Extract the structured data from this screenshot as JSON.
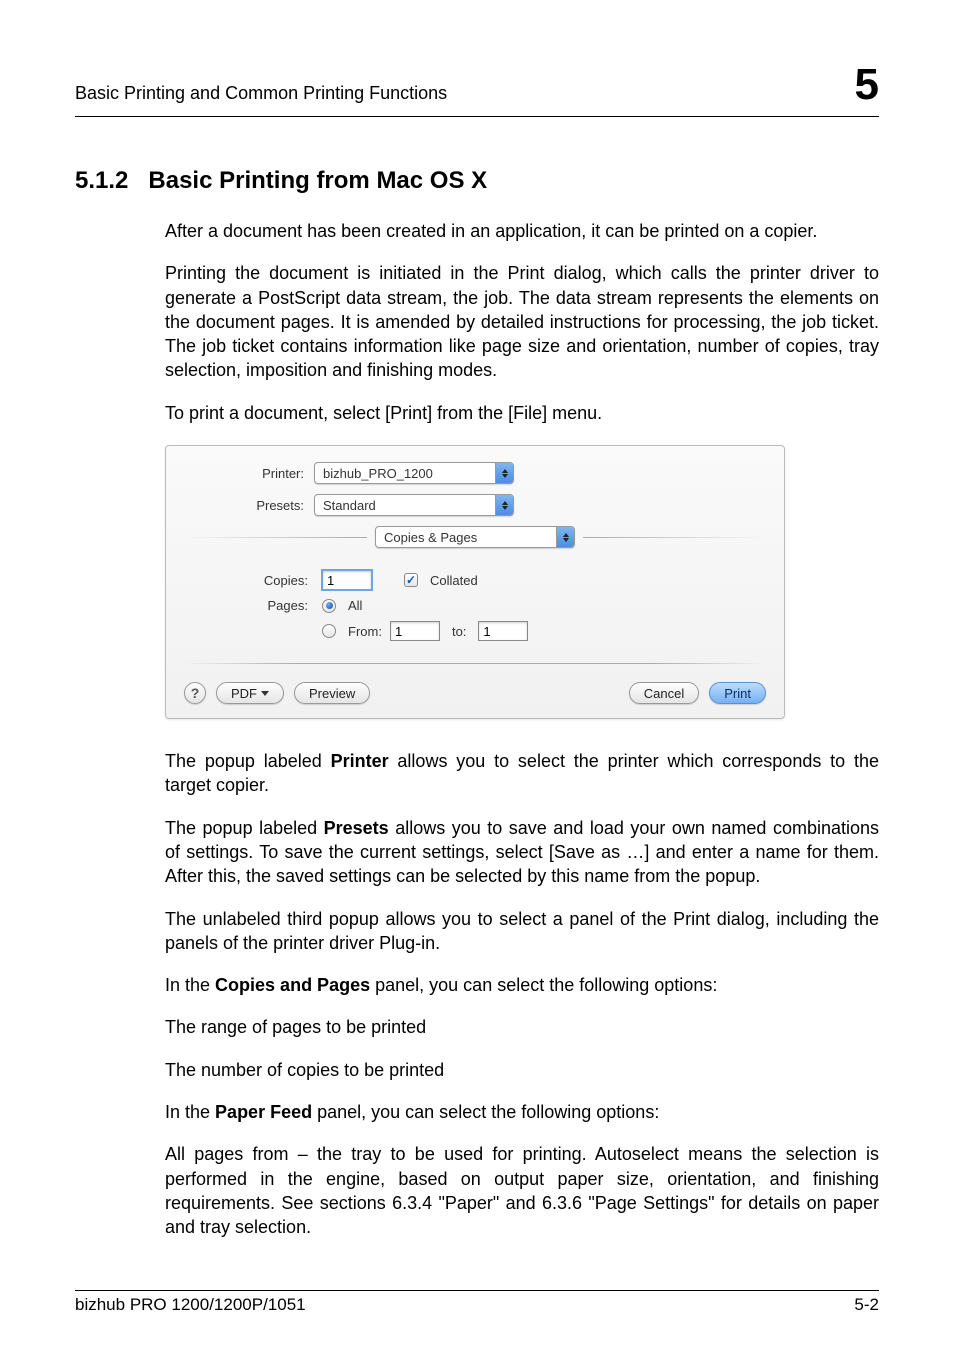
{
  "header": {
    "title": "Basic Printing and Common Printing Functions",
    "chapter": "5"
  },
  "section": {
    "number": "5.1.2",
    "title": "Basic Printing from Mac OS X"
  },
  "paragraphs": {
    "p1": "After a document has been created in an application, it can be printed on a copier.",
    "p2": "Printing the document is initiated in the Print dialog, which calls the printer driver to generate a PostScript data stream, the job. The data stream represents the elements on the document pages. It is amended by detailed instructions for processing, the job ticket. The job ticket contains information like page size and orientation, number of copies, tray selection, imposition and finishing modes.",
    "p3": "To print a document, select [Print] from the [File] menu.",
    "p4a": "The popup labeled ",
    "p4b": "Printer",
    "p4c": " allows you to select the printer which corresponds to the target copier.",
    "p5a": "The popup labeled ",
    "p5b": "Presets",
    "p5c": " allows you to save and load your own named combinations of settings. To save the current settings, select [Save as …] and enter a name for them. After this, the saved settings can be selected by this name from the popup.",
    "p6": "The unlabeled third popup allows you to select a panel of the Print dialog, including the panels of the printer driver Plug-in.",
    "p7a": "In the ",
    "p7b": "Copies and Pages",
    "p7c": " panel, you can select the following options:",
    "p8": "The range of pages to be printed",
    "p9": "The number of copies to be printed",
    "p10a": "In the ",
    "p10b": "Paper Feed",
    "p10c": " panel, you can select the following options:",
    "p11": "All pages from – the tray to be used for printing. Autoselect means the selection is performed in the engine, based on output paper size, orientation, and finishing requirements. See sections 6.3.4 \"Paper\" and 6.3.6 \"Page Settings\" for details on paper and tray selection."
  },
  "dialog": {
    "printer_label": "Printer:",
    "printer_value": "bizhub_PRO_1200",
    "presets_label": "Presets:",
    "presets_value": "Standard",
    "panel_value": "Copies & Pages",
    "copies_label": "Copies:",
    "copies_value": "1",
    "collated_label": "Collated",
    "pages_label": "Pages:",
    "all_label": "All",
    "from_label": "From:",
    "from_value": "1",
    "to_label": "to:",
    "to_value": "1",
    "help": "?",
    "pdf": "PDF",
    "preview": "Preview",
    "cancel": "Cancel",
    "print": "Print"
  },
  "footer": {
    "left": "bizhub PRO 1200/1200P/1051",
    "right": "5-2"
  }
}
